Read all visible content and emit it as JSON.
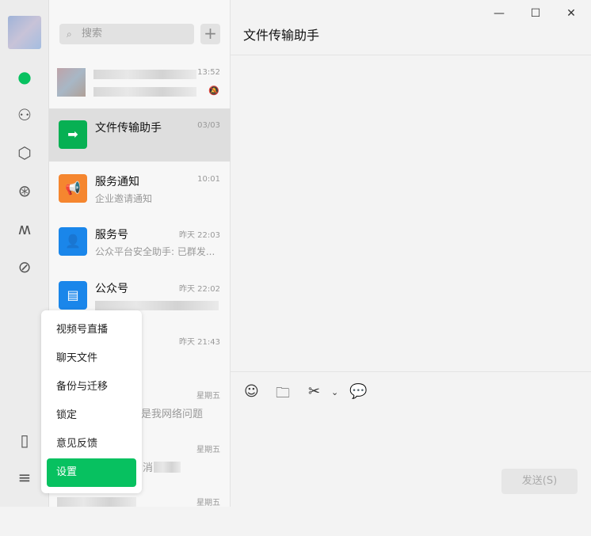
{
  "window": {
    "title": "文件传输助手",
    "minimize": "—",
    "maximize": "☐",
    "close": "✕"
  },
  "search": {
    "placeholder": "搜索",
    "icon": "search-icon",
    "add": "+"
  },
  "chats": [
    {
      "name": "",
      "time": "13:52",
      "preview": ""
    },
    {
      "name": "文件传输助手",
      "time": "03/03",
      "preview": "",
      "color": "#07b053"
    },
    {
      "name": "服务通知",
      "time": "10:01",
      "preview": "企业邀请通知",
      "color": "#f5862f"
    },
    {
      "name": "服务号",
      "time": "昨天 22:03",
      "preview": "公众平台安全助手: 已群发...",
      "color": "#1a86ea"
    },
    {
      "name": "公众号",
      "time": "昨天 22:02",
      "preview": "",
      "color": "#1a86ea"
    },
    {
      "name": "",
      "time": "昨天 21:43",
      "preview": ""
    },
    {
      "name": "",
      "time": "星期五",
      "preview": "是我网络问题"
    },
    {
      "name": "",
      "time": "星期五",
      "preview": "消"
    },
    {
      "name": "",
      "time": "星期五",
      "preview": ""
    }
  ],
  "menu": [
    "视频号直播",
    "聊天文件",
    "备份与迁移",
    "锁定",
    "意见反馈",
    "设置"
  ],
  "composer": {
    "send": "发送(S)"
  }
}
